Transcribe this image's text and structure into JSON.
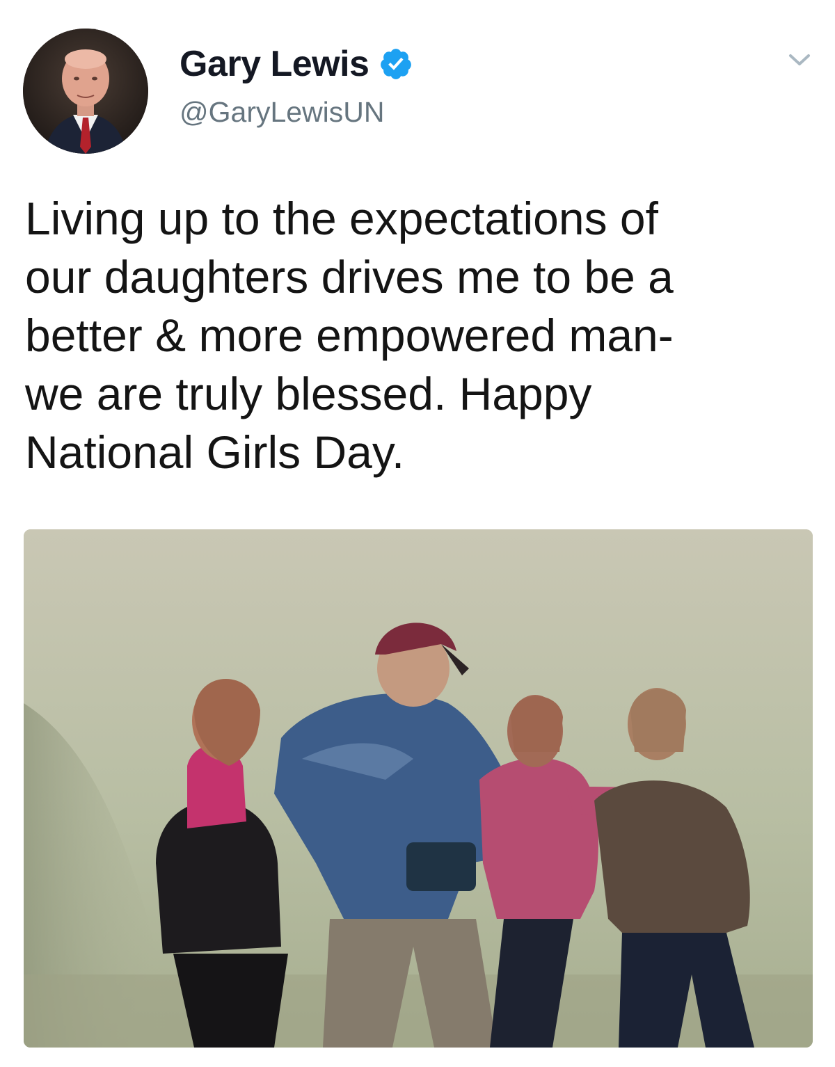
{
  "user": {
    "display_name": "Gary Lewis",
    "handle": "@GaryLewisUN",
    "verified": true,
    "avatar_icon": "profile-photo",
    "verified_icon": "verified-badge-icon"
  },
  "tweet": {
    "text": "Living up to the expectations of\nour daughters drives me to be a\nbetter & more empowered man-\nwe are truly blessed. Happy\nNational Girls Day.",
    "media_alt": "photo"
  },
  "menu": {
    "icon": "chevron-down-icon"
  },
  "colors": {
    "verified_blue": "#1da1f2",
    "handle_gray": "#66757f",
    "name_black": "#141823"
  }
}
